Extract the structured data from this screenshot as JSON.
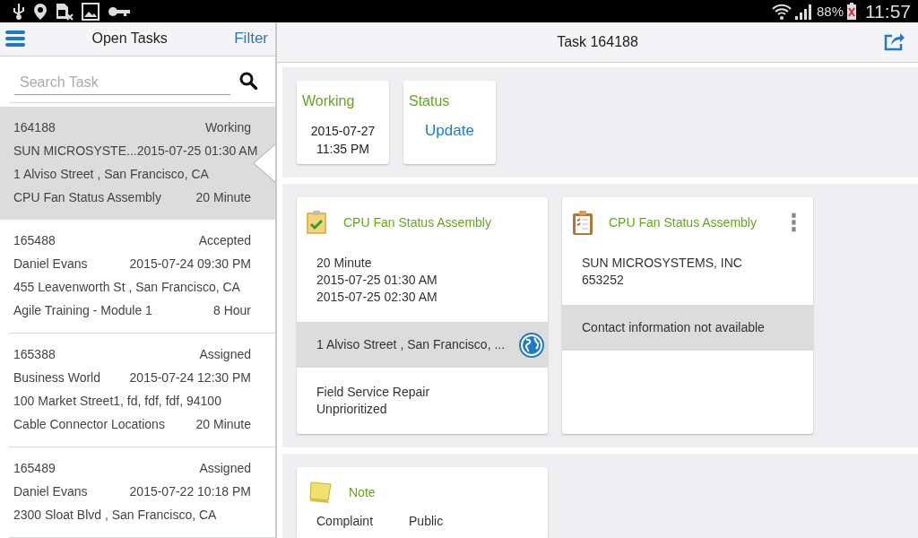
{
  "status_bar": {
    "battery": "88%",
    "time": "11:57"
  },
  "sidebar": {
    "title": "Open Tasks",
    "filter": "Filter",
    "search": {
      "placeholder": "Search Task"
    },
    "tasks": [
      {
        "id": "164188",
        "status": "Working",
        "customer": "SUN MICROSYSTE...",
        "datetime": "2015-07-25 01:30 AM",
        "address": "1 Alviso Street , San Francisco, CA",
        "title": "CPU Fan Status Assembly",
        "duration": "20 Minute",
        "selected": true
      },
      {
        "id": "165488",
        "status": "Accepted",
        "customer": "Daniel Evans",
        "datetime": "2015-07-24 09:30 PM",
        "address": "455 Leavenworth St , San Francisco, CA",
        "title": "Agile Training - Module 1",
        "duration": "8 Hour",
        "selected": false
      },
      {
        "id": "165388",
        "status": "Assigned",
        "customer": "Business World",
        "datetime": "2015-07-24 12:30 PM",
        "address": "100 Market Street1, fd, fdf, fdf, 94100",
        "title": "Cable Connector Locations",
        "duration": "20 Minute",
        "selected": false
      },
      {
        "id": "165489",
        "status": "Assigned",
        "customer": "Daniel Evans",
        "datetime": "2015-07-22 10:18 PM",
        "address": "2300 Sloat Blvd , San Francisco, CA",
        "selected": false
      }
    ]
  },
  "detail": {
    "title": "Task 164188",
    "status_cards": [
      {
        "kind": "info",
        "heading": "Working",
        "lines": [
          "2015-07-27",
          "11:35 PM"
        ]
      },
      {
        "kind": "action",
        "heading": "Status",
        "action": "Update"
      }
    ],
    "task_card": {
      "title": "CPU Fan Status Assembly",
      "lines": [
        "20 Minute",
        "2015-07-25 01:30 AM",
        "2015-07-25 02:30 AM"
      ],
      "address": "1 Alviso Street , San Francisco, ...",
      "footer": [
        "Field Service Repair",
        "Unprioritized"
      ]
    },
    "customer_card": {
      "title": "CPU Fan Status Assembly",
      "lines": [
        "SUN MICROSYSTEMS, INC",
        "653252"
      ],
      "contact": "Contact information not available"
    },
    "note_card": {
      "title": "Note",
      "fields": [
        "Complaint",
        "Public"
      ]
    }
  }
}
